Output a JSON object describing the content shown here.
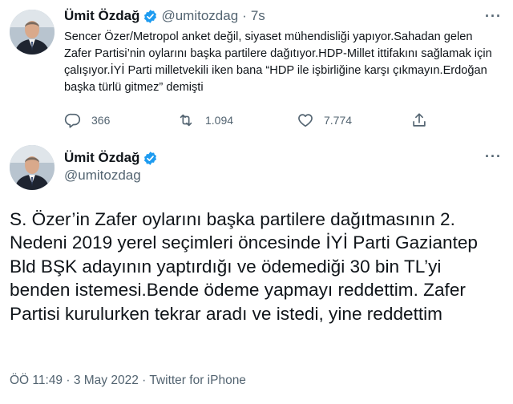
{
  "tweet_reply": {
    "author_name": "Ümit Özdağ",
    "handle": "@umitozdag",
    "separator": "·",
    "time": "7s",
    "text": "Sencer Özer/Metropol anket değil, siyaset mühendisliği yapıyor.Sahadan gelen Zafer Partisi’nin oylarını başka partilere dağıtıyor.HDP-Millet ittifakını sağlamak için çalışıyor.İYİ Parti milletvekili iken bana “HDP ile işbirliğine karşı çıkmayın.Erdoğan başka türlü gitmez” demişti",
    "more_label": "···",
    "replies": "366",
    "retweets": "1.094",
    "likes": "7.774"
  },
  "tweet_main": {
    "author_name": "Ümit Özdağ",
    "handle": "@umitozdag",
    "more_label": "···",
    "text": "S. Özer’in Zafer oylarını başka partilere dağıtmasının 2. Nedeni 2019 yerel seçimleri öncesinde İYİ Parti Gaziantep Bld BŞK adayının yaptırdığı ve ödemediği 30 bin TL’yi benden istemesi.Bende ödeme yapmayı reddettim. Zafer Partisi kurulurken tekrar aradı ve istedi, yine reddettim",
    "meta": "ÖÖ 11:49 · 3 May 2022 · Twitter for iPhone"
  },
  "icons": {
    "verified": "verified-badge-icon",
    "reply": "reply-icon",
    "retweet": "retweet-icon",
    "like": "heart-icon",
    "share": "share-icon"
  },
  "colors": {
    "verified": "#1d9bf0",
    "secondary_text": "#536471",
    "primary_text": "#0f1419"
  }
}
